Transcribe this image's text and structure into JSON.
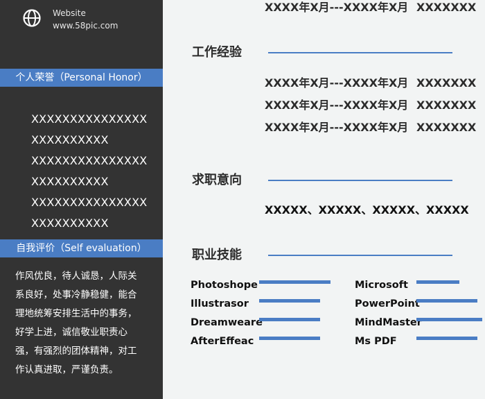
{
  "header": {
    "website_label": "Website",
    "website_url": "www.58pic.com"
  },
  "honor": {
    "title": "个人荣誉（Personal Honor）",
    "lines": [
      "XXXXXXXXXXXXXXX",
      "XXXXXXXXXX",
      "XXXXXXXXXXXXXXX",
      "XXXXXXXXXX",
      "XXXXXXXXXXXXXXX",
      "XXXXXXXXXX"
    ]
  },
  "self_eval": {
    "title": "自我评价（Self evaluation）",
    "lines": [
      "作风优良，待人诚恳，人际关",
      "系良好，处事冷静稳健，能合",
      "理地统筹安排生活中的事务，",
      "好学上进，诚信敬业职责心",
      "强，有强烈的团体精神，对工",
      "作认真进取，严谨负责。"
    ]
  },
  "education": {
    "rows": [
      {
        "period": "XXXX年X月---XXXX年X月",
        "value": "XXXXXXX"
      }
    ]
  },
  "work": {
    "title": "工作经验",
    "rows": [
      {
        "period": "XXXX年X月---XXXX年X月",
        "value": "XXXXXXX"
      },
      {
        "period": "XXXX年X月---XXXX年X月",
        "value": "XXXXXXX"
      },
      {
        "period": "XXXX年X月---XXXX年X月",
        "value": "XXXXXXX"
      }
    ]
  },
  "intent": {
    "title": "求职意向",
    "text": "XXXXX、XXXXX、XXXXX、XXXXX"
  },
  "skills": {
    "title": "职业技能",
    "items": [
      {
        "name": "Photoshope",
        "level": 0.47
      },
      {
        "name": "Illustrasor",
        "level": 0.4
      },
      {
        "name": "Dreamweare",
        "level": 0.4
      },
      {
        "name": "AfterEffeac",
        "level": 0.4
      },
      {
        "name": "Microsoft",
        "level": 0.28
      },
      {
        "name": "PowerPoint",
        "level": 0.4
      },
      {
        "name": "MindMaster",
        "level": 0.43
      },
      {
        "name": "Ms PDF",
        "level": 0.4
      }
    ]
  },
  "colors": {
    "sidebar_bg": "#333333",
    "accent": "#4a7dc4",
    "page_bg": "#f2f4f4"
  },
  "icons": {
    "website": "globe-icon"
  }
}
